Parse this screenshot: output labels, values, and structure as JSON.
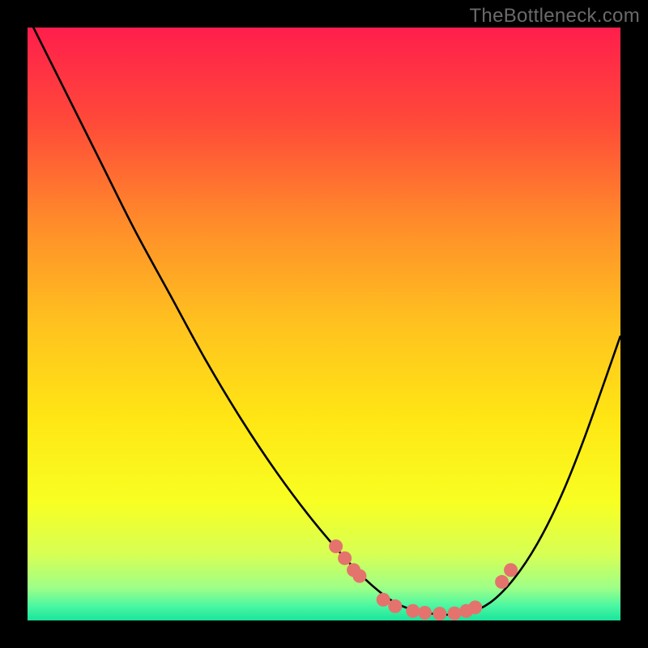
{
  "watermark": "TheBottleneck.com",
  "chart_data": {
    "type": "line",
    "title": "",
    "xlabel": "",
    "ylabel": "",
    "xlim": [
      0,
      100
    ],
    "ylim": [
      0,
      100
    ],
    "grid": false,
    "legend": false,
    "background_gradient": {
      "stops": [
        {
          "offset": 0.0,
          "color": "#ff1e4c"
        },
        {
          "offset": 0.16,
          "color": "#ff4a39"
        },
        {
          "offset": 0.33,
          "color": "#ff8c2a"
        },
        {
          "offset": 0.5,
          "color": "#ffc21f"
        },
        {
          "offset": 0.66,
          "color": "#ffe614"
        },
        {
          "offset": 0.8,
          "color": "#f8ff22"
        },
        {
          "offset": 0.89,
          "color": "#d6ff55"
        },
        {
          "offset": 0.945,
          "color": "#9eff88"
        },
        {
          "offset": 0.975,
          "color": "#4cf7a2"
        },
        {
          "offset": 1.0,
          "color": "#19e59b"
        }
      ]
    },
    "series": [
      {
        "name": "bottleneck-curve",
        "x": [
          0,
          6,
          12,
          18,
          24,
          30,
          36,
          42,
          48,
          54,
          58,
          62,
          66,
          70,
          74,
          78,
          82,
          86,
          90,
          94,
          100
        ],
        "y": [
          102,
          90,
          78,
          66,
          55,
          44,
          34,
          25,
          17,
          10,
          6,
          3,
          1.5,
          1,
          1.2,
          3,
          7,
          13,
          21,
          31,
          48
        ]
      }
    ],
    "markers": {
      "name": "highlight-points",
      "color": "#e4736e",
      "radius": 8.5,
      "x": [
        52,
        53.5,
        55,
        56,
        60,
        62,
        65,
        67,
        69.5,
        72,
        74,
        75.5,
        80,
        81.5
      ],
      "y": [
        12.5,
        10.5,
        8.5,
        7.5,
        3.5,
        2.4,
        1.6,
        1.3,
        1.15,
        1.2,
        1.6,
        2.2,
        6.5,
        8.5
      ]
    }
  }
}
